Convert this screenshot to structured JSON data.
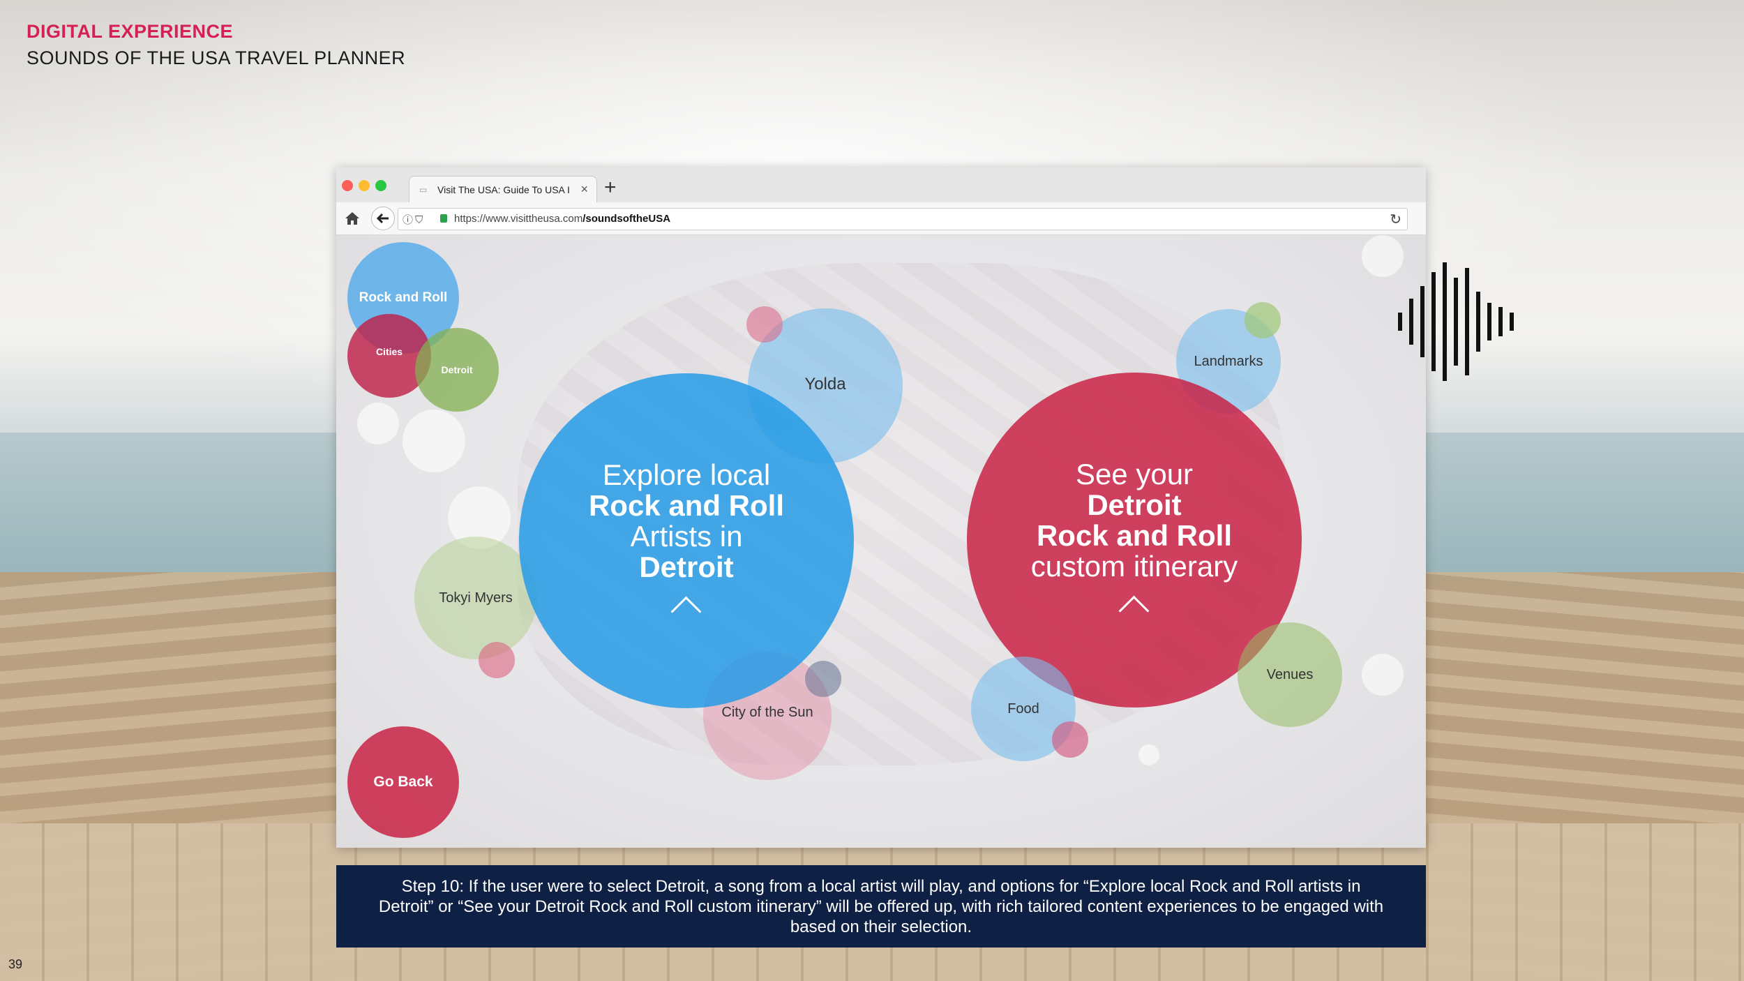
{
  "header": {
    "eyebrow": "DIGITAL EXPERIENCE",
    "title": "SOUNDS OF THE USA TRAVEL PLANNER"
  },
  "page_number": "39",
  "browser": {
    "tab_title": "Visit The USA: Guide To USA I",
    "url_base": "https://www.visittheusa.com",
    "url_path": "/soundsoftheUSA"
  },
  "bubbles": {
    "rock_and_roll": "Rock and Roll",
    "cities": "Cities",
    "detroit_small": "Detroit",
    "yolda": "Yolda",
    "tokyi_myers": "Tokyi Myers",
    "city_of_the_sun": "City of the Sun",
    "landmarks": "Landmarks",
    "food": "Food",
    "venues": "Venues",
    "go_back": "Go Back"
  },
  "explore": {
    "line1": "Explore local",
    "line2": "Rock and Roll",
    "line3": "Artists in",
    "line4": "Detroit"
  },
  "itinerary": {
    "line1": "See your",
    "line2": "Detroit",
    "line3": "Rock and Roll",
    "line4": "custom itinerary"
  },
  "caption": "Step 10: If the user were to select Detroit, a song from a local artist will play, and options for “Explore local Rock and Roll artists in Detroit” or  “See your Detroit Rock and Roll custom itinerary” will be offered up, with rich tailored content experiences to be engaged with based on their selection.",
  "colors": {
    "accent_pink": "#d61f55",
    "blue": "#269be6",
    "red": "#c81c40",
    "navy": "#0e2044"
  },
  "icons": [
    "home-icon",
    "back-arrow-icon",
    "info-icon",
    "shield-icon",
    "lock-icon",
    "reload-icon",
    "sound-wave-icon",
    "chevron-up-icon"
  ]
}
